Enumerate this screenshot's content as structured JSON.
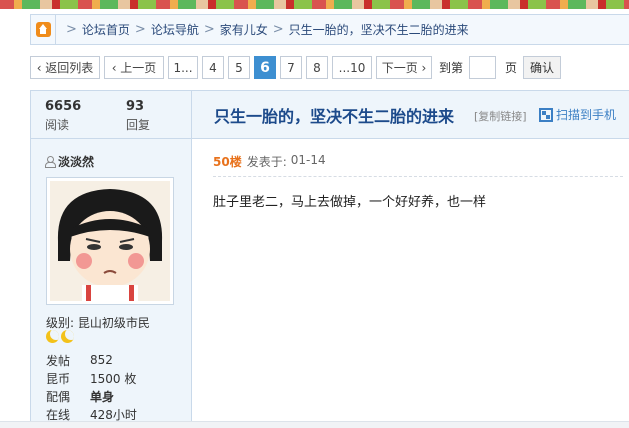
{
  "breadcrumb": {
    "items": [
      "论坛首页",
      "论坛导航",
      "家有儿女",
      "只生一胎的，坚决不生二胎的进来"
    ],
    "separator": ">"
  },
  "pager": {
    "back": "‹ 返回列表",
    "prev": "‹ 上一页",
    "pages": [
      "1...",
      "4",
      "5",
      "6",
      "7",
      "8",
      "...10"
    ],
    "current": "6",
    "next": "下一页 ›",
    "goto_label": "到第",
    "page_unit": "页",
    "goto_value": "",
    "confirm": "确认"
  },
  "thread": {
    "views": "6656",
    "views_label": "阅读",
    "replies": "93",
    "replies_label": "回复",
    "title": "只生一胎的，坚决不生二胎的进来",
    "copy_link": "[复制链接]",
    "qr_label": "扫描到手机"
  },
  "user": {
    "name": "淡淡然",
    "level_label": "级别:",
    "level": "昆山初级市民",
    "stats": [
      {
        "key": "发帖",
        "value": "852",
        "bold": false
      },
      {
        "key": "昆币",
        "value": "1500 枚",
        "bold": false
      },
      {
        "key": "配偶",
        "value": "单身",
        "bold": true
      },
      {
        "key": "在线",
        "value": "428小时",
        "bold": false
      }
    ]
  },
  "post": {
    "floor": "50楼",
    "posted_label": "发表于:",
    "posted_time": "01-14",
    "body": "肚子里老二，马上去做掉，一个好好养，也一样"
  },
  "colors": {
    "title": "#1c4a8b",
    "floor": "#e8721c",
    "current_page": "#3d8fd1",
    "panel_bg": "#eef5fb"
  },
  "icons": [
    "home-icon",
    "user-icon",
    "qr-code-icon",
    "moon-icon"
  ]
}
